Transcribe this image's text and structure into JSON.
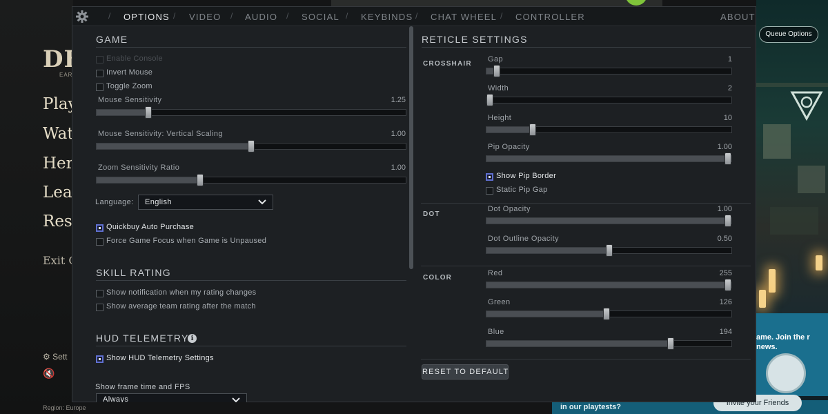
{
  "background": {
    "logo": "DE",
    "logo_sub": "EARL",
    "menu": [
      "Play",
      "Wat",
      "Her",
      "Lear",
      "Rese"
    ],
    "exit": "Exit G",
    "settings": "Sett",
    "region": "Region: Europe",
    "queue_options": "Queue Options",
    "news_text": "ame. Join the r news.",
    "playtest_text": "in our playtests?",
    "invite": "Invite your Friends"
  },
  "tabs": [
    {
      "label": "OPTIONS",
      "active": true
    },
    {
      "label": "VIDEO"
    },
    {
      "label": "AUDIO"
    },
    {
      "label": "SOCIAL"
    },
    {
      "label": "KEYBINDS"
    },
    {
      "label": "CHAT WHEEL"
    },
    {
      "label": "CONTROLLER"
    },
    {
      "label": "ABOUT"
    }
  ],
  "game": {
    "title": "GAME",
    "checkboxes": [
      {
        "label": "Enable Console",
        "checked": false,
        "disabled": true
      },
      {
        "label": "Invert Mouse",
        "checked": false
      },
      {
        "label": "Toggle Zoom",
        "checked": false
      }
    ],
    "sliders": [
      {
        "label": "Mouse Sensitivity",
        "value": "1.25",
        "fraction": 0.16
      },
      {
        "label": "Mouse Sensitivity: Vertical Scaling",
        "value": "1.00",
        "fraction": 0.5
      },
      {
        "label": "Zoom Sensitivity Ratio",
        "value": "1.00",
        "fraction": 0.33
      }
    ],
    "language_label": "Language:",
    "language_value": "English",
    "options": [
      {
        "label": "Quickbuy Auto Purchase",
        "checked": false,
        "focused": true
      },
      {
        "label": "Force Game Focus when Game is Unpaused",
        "checked": false
      }
    ]
  },
  "skill_rating": {
    "title": "SKILL RATING",
    "checkboxes": [
      {
        "label": "Show notification when my rating changes",
        "checked": false
      },
      {
        "label": "Show average team rating after the match",
        "checked": false
      }
    ]
  },
  "hud_telemetry": {
    "title": "HUD TELEMETRY",
    "checkbox": {
      "label": "Show HUD Telemetry Settings",
      "checked": false,
      "focused": true
    },
    "frame_label": "Show frame time and FPS",
    "frame_value": "Always"
  },
  "reticle": {
    "title": "RETICLE SETTINGS",
    "crosshair_label": "CROSSHAIR",
    "crosshair_sliders": [
      {
        "label": "Gap",
        "value": "1",
        "fraction": 0.03
      },
      {
        "label": "Width",
        "value": "2",
        "fraction": 0.0
      },
      {
        "label": "Height",
        "value": "10",
        "fraction": 0.18
      },
      {
        "label": "Pip Opacity",
        "value": "1.00",
        "fraction": 1.0
      }
    ],
    "pip_checkboxes": [
      {
        "label": "Show Pip Border",
        "checked": false,
        "focused": true
      },
      {
        "label": "Static Pip Gap",
        "checked": false
      }
    ],
    "dot_label": "DOT",
    "dot_sliders": [
      {
        "label": "Dot Opacity",
        "value": "1.00",
        "fraction": 1.0
      },
      {
        "label": "Dot Outline Opacity",
        "value": "0.50",
        "fraction": 0.5
      }
    ],
    "color_label": "COLOR",
    "color_sliders": [
      {
        "label": "Red",
        "value": "255",
        "fraction": 1.0
      },
      {
        "label": "Green",
        "value": "126",
        "fraction": 0.49
      },
      {
        "label": "Blue",
        "value": "194",
        "fraction": 0.76
      }
    ],
    "reset_label": "RESET TO DEFAULT"
  },
  "icons": {
    "gear": "gear-icon",
    "chevron": "chevron-down-icon",
    "info": "info-icon"
  }
}
